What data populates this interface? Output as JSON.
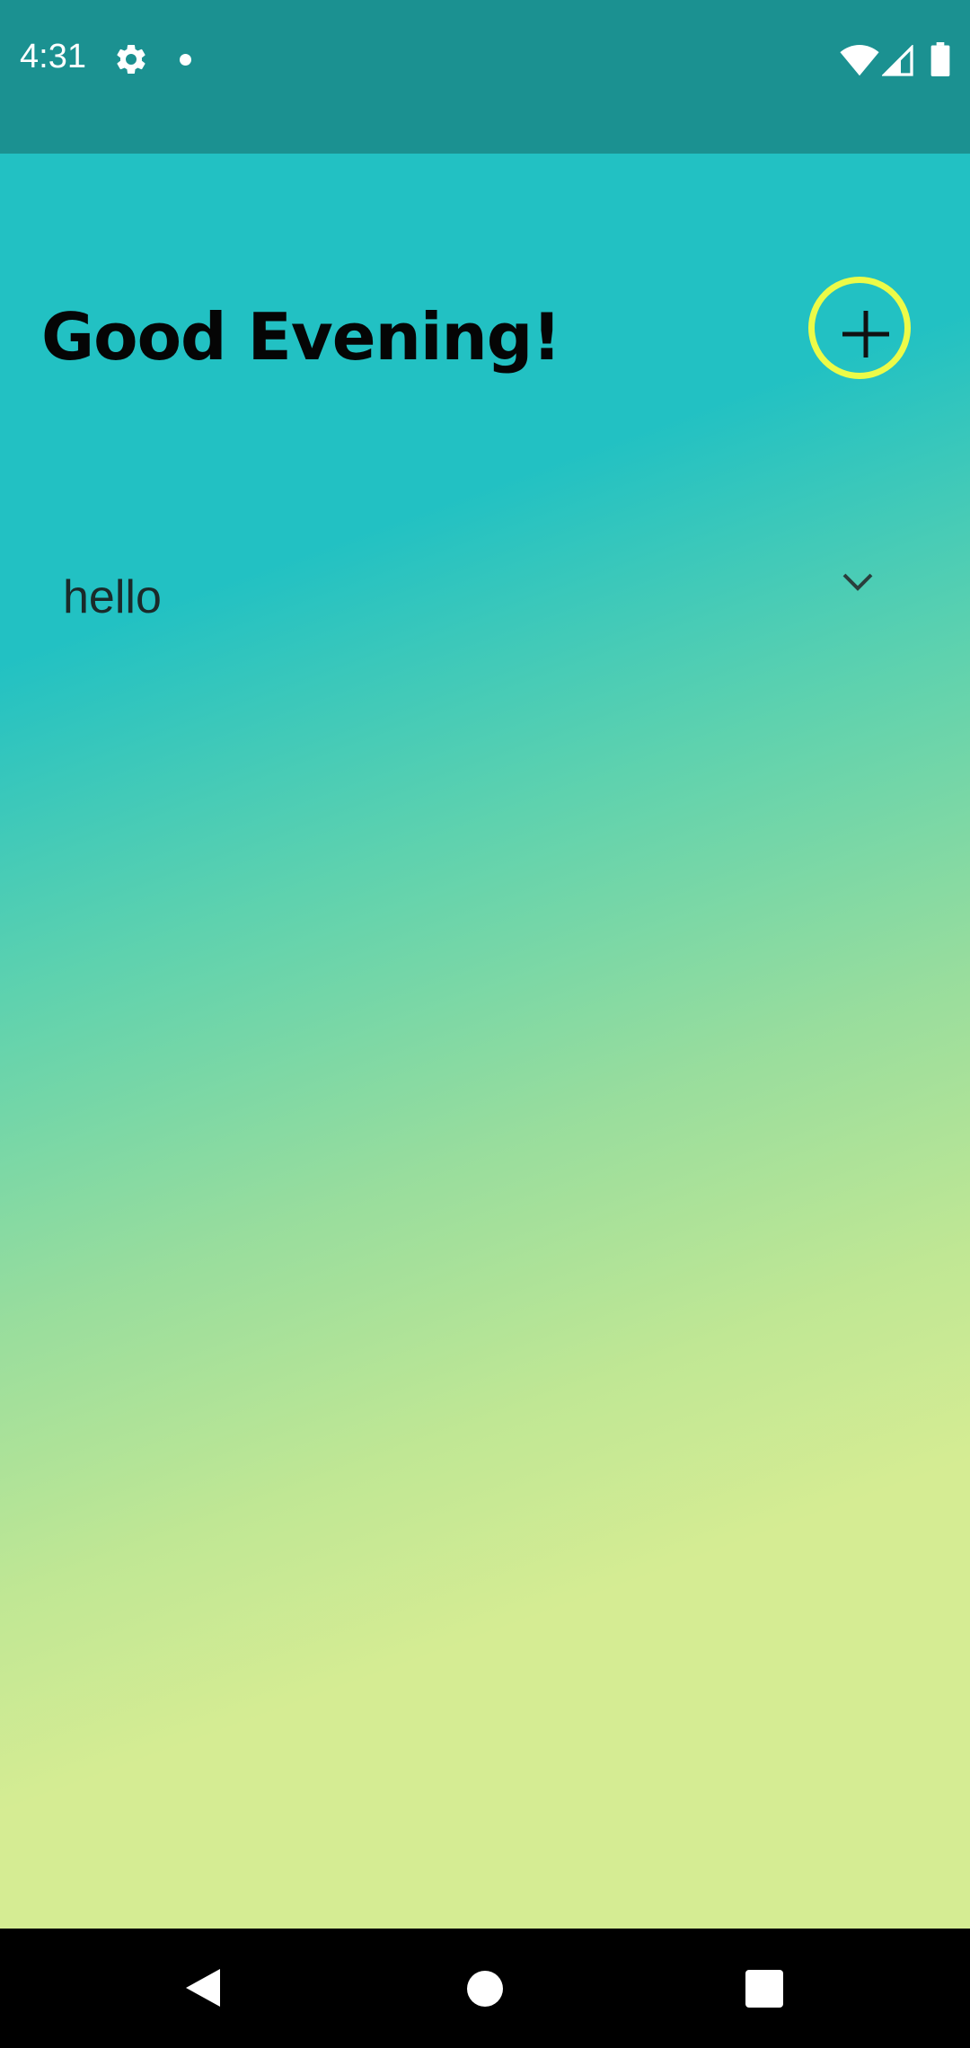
{
  "status_bar": {
    "time": "4:31",
    "icons": [
      "gear-icon",
      "notification-dot-icon",
      "wifi-icon",
      "cellular-signal-icon",
      "battery-icon"
    ]
  },
  "header": {
    "greeting": "Good Evening!",
    "add_icon": "plus-icon",
    "add_ring_color": "#ecfb48"
  },
  "notes": [
    {
      "title": "hello",
      "expand_icon": "chevron-down-icon"
    }
  ],
  "nav_bar": {
    "icons": [
      "back-icon",
      "home-icon",
      "recents-icon"
    ]
  },
  "colors": {
    "status_bar": "#1b9191",
    "gradient_start": "#22c1c3",
    "gradient_end": "#d5ec93",
    "accent": "#ecfb48"
  }
}
